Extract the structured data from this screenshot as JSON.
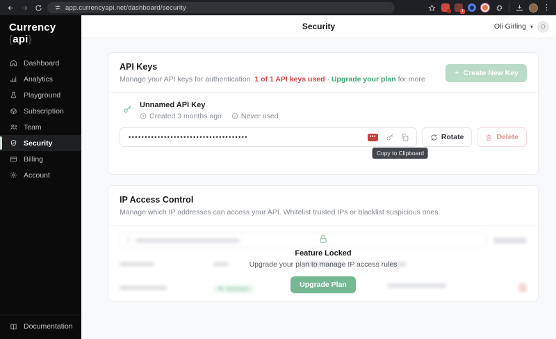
{
  "browser": {
    "url": "app.currencyapi.net/dashboard/security",
    "extension_badge": "1"
  },
  "sidebar": {
    "logo": {
      "brand": "Currency",
      "brace_open": "{",
      "suffix": "api",
      "brace_close": "}"
    },
    "items": [
      {
        "label": "Dashboard"
      },
      {
        "label": "Analytics"
      },
      {
        "label": "Playground"
      },
      {
        "label": "Subscription"
      },
      {
        "label": "Team"
      },
      {
        "label": "Security"
      },
      {
        "label": "Billing"
      },
      {
        "label": "Account"
      }
    ],
    "footer": {
      "label": "Documentation"
    }
  },
  "header": {
    "title": "Security",
    "user": "Oli Girling",
    "caret": "▾",
    "avatar_initial": "O"
  },
  "api_keys": {
    "title": "API Keys",
    "subtitle_prefix": "Manage your API keys for authentication.",
    "usage_warning": "1 of 1 API keys used",
    "separator": "·",
    "upgrade_link": "Upgrade your plan",
    "subtitle_suffix": "for more",
    "create_button": "Create New Key",
    "key": {
      "name": "Unnamed API Key",
      "created": "Created 3 months ago",
      "usage": "Never used",
      "masked_value": "•••••••••••••••••••••••••••••••••••••",
      "pm_ext_glyph": "•••",
      "rotate_label": "Rotate",
      "delete_label": "Delete",
      "copy_tooltip": "Copy to Clipboard"
    }
  },
  "ip_access": {
    "title": "IP Access Control",
    "subtitle": "Manage which IP addresses can access your API. Whitelist trusted IPs or blacklist suspicious ones.",
    "locked": {
      "title": "Feature Locked",
      "description": "Upgrade your plan to manage IP access rules",
      "button": "Upgrade Plan"
    }
  },
  "colors": {
    "accent_green": "#74b894",
    "warning_red": "#d64545",
    "link_green": "#3fa878",
    "sidebar_bg": "#0b0b0c"
  }
}
